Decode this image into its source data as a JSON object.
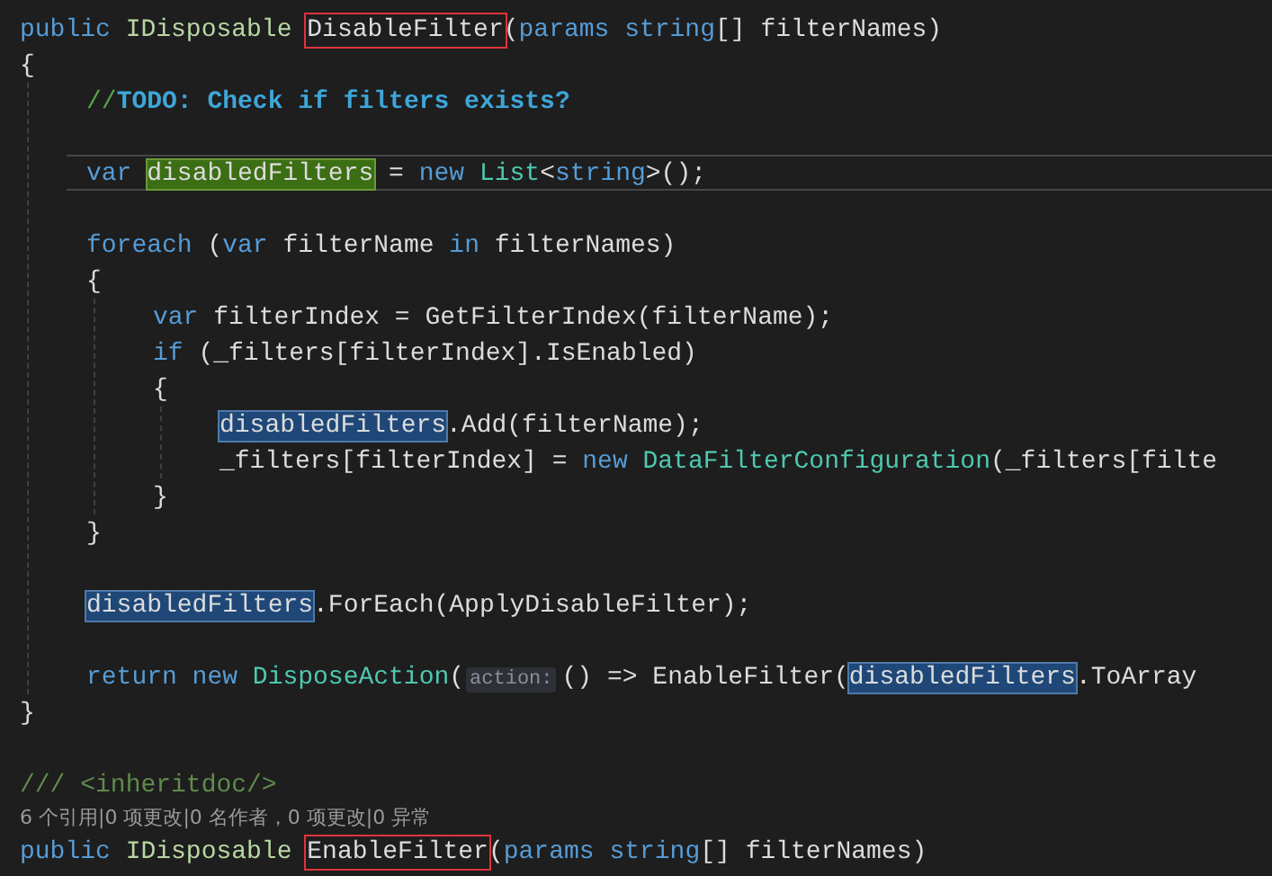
{
  "editor": {
    "lines": [
      {
        "kind": "code",
        "tokens": [
          {
            "text": "public ",
            "kind": "keyword"
          },
          {
            "text": "IDisposable ",
            "kind": "interface"
          },
          {
            "text": "DisableFilter",
            "kind": "boxed"
          },
          {
            "text": "("
          },
          {
            "text": "params ",
            "kind": "keyword"
          },
          {
            "text": "string",
            "kind": "keyword"
          },
          {
            "text": "[] filterNames)"
          }
        ]
      },
      {
        "kind": "code",
        "tokens": [
          {
            "text": "{"
          }
        ],
        "children": [
          {
            "kind": "code",
            "tokens": [
              {
                "text": "//",
                "kind": "comment"
              },
              {
                "text": "TODO: Check if filters exists?",
                "kind": "todo"
              }
            ]
          },
          {
            "kind": "blank"
          },
          {
            "kind": "code",
            "current": true,
            "tokens": [
              {
                "text": "var ",
                "kind": "keyword"
              },
              {
                "text": "disabledFilters",
                "kind": "write-ref"
              },
              {
                "text": " = "
              },
              {
                "text": "new ",
                "kind": "keyword"
              },
              {
                "text": "List",
                "kind": "type"
              },
              {
                "text": "<"
              },
              {
                "text": "string",
                "kind": "keyword"
              },
              {
                "text": ">();"
              }
            ]
          },
          {
            "kind": "blank"
          },
          {
            "kind": "code",
            "tokens": [
              {
                "text": "foreach",
                "kind": "keyword"
              },
              {
                "text": " ("
              },
              {
                "text": "var",
                "kind": "keyword"
              },
              {
                "text": " filterName "
              },
              {
                "text": "in",
                "kind": "keyword"
              },
              {
                "text": " filterNames)"
              }
            ]
          },
          {
            "kind": "code",
            "tokens": [
              {
                "text": "{"
              }
            ],
            "children": [
              {
                "kind": "code",
                "tokens": [
                  {
                    "text": "var",
                    "kind": "keyword"
                  },
                  {
                    "text": " filterIndex = GetFilterIndex(filterName);"
                  }
                ]
              },
              {
                "kind": "code",
                "tokens": [
                  {
                    "text": "if",
                    "kind": "keyword"
                  },
                  {
                    "text": " (_filters[filterIndex].IsEnabled)"
                  }
                ]
              },
              {
                "kind": "code",
                "tokens": [
                  {
                    "text": "{"
                  }
                ],
                "children": [
                  {
                    "kind": "code",
                    "tokens": [
                      {
                        "text": "disabledFilters",
                        "kind": "read-ref"
                      },
                      {
                        "text": ".Add(filterName);"
                      }
                    ]
                  },
                  {
                    "kind": "code",
                    "tokens": [
                      {
                        "text": "_filters[filterIndex] = "
                      },
                      {
                        "text": "new ",
                        "kind": "keyword"
                      },
                      {
                        "text": "DataFilterConfiguration",
                        "kind": "type"
                      },
                      {
                        "text": "(_filters[filte"
                      }
                    ]
                  }
                ]
              },
              {
                "kind": "code",
                "tokens": [
                  {
                    "text": "}"
                  }
                ]
              }
            ]
          },
          {
            "kind": "code",
            "tokens": [
              {
                "text": "}"
              }
            ]
          },
          {
            "kind": "blank"
          },
          {
            "kind": "code",
            "tokens": [
              {
                "text": "disabledFilters",
                "kind": "read-ref"
              },
              {
                "text": ".ForEach(ApplyDisableFilter);"
              }
            ]
          },
          {
            "kind": "blank"
          },
          {
            "kind": "code",
            "tokens": [
              {
                "text": "return new ",
                "kind": "keyword"
              },
              {
                "text": "DisposeAction",
                "kind": "type"
              },
              {
                "text": "("
              },
              {
                "text": "action:",
                "kind": "hint"
              },
              {
                "text": "() => EnableFilter("
              },
              {
                "text": "disabledFilters",
                "kind": "read-ref"
              },
              {
                "text": ".ToArray"
              }
            ]
          }
        ]
      },
      {
        "kind": "code",
        "tokens": [
          {
            "text": "}"
          }
        ]
      },
      {
        "kind": "blank"
      },
      {
        "kind": "code",
        "tokens": [
          {
            "text": "/// ",
            "kind": "doc"
          },
          {
            "text": "<inheritdoc/>",
            "kind": "doc"
          }
        ]
      },
      {
        "kind": "codelens",
        "text": "6 个引用|0 项更改|0 名作者，0 项更改|0 异常"
      },
      {
        "kind": "code",
        "tokens": [
          {
            "text": "public ",
            "kind": "keyword"
          },
          {
            "text": "IDisposable ",
            "kind": "interface"
          },
          {
            "text": "EnableFilter",
            "kind": "boxed"
          },
          {
            "text": "("
          },
          {
            "text": "params ",
            "kind": "keyword"
          },
          {
            "text": "string",
            "kind": "keyword"
          },
          {
            "text": "[] filterNames)"
          }
        ]
      }
    ]
  }
}
